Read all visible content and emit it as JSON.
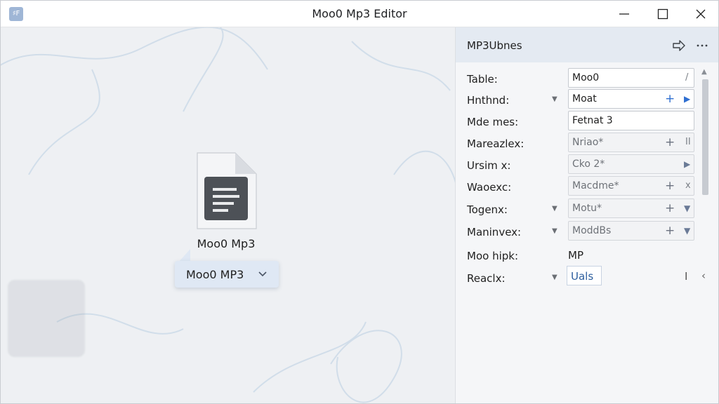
{
  "window": {
    "title": "Moo0 Mp3 Editor",
    "app_icon_glyph": "♯F"
  },
  "canvas": {
    "file_name": "Moo0 Mp3",
    "format_dropdown": {
      "selected": "Moo0 MP3"
    }
  },
  "panel": {
    "title": "MP3Ubnes",
    "rows": [
      {
        "label": "Table:",
        "value": "Moo0",
        "control": "text-field",
        "end_mark": "/",
        "disabled": false
      },
      {
        "label": "Hnthnd:",
        "value": "Moat",
        "control": "stepper-field",
        "has_dropdown": true,
        "disabled": false
      },
      {
        "label": "Mde mes:",
        "value": "Fetnat 3",
        "control": "text-field",
        "disabled": false
      },
      {
        "label": "Mareazlex:",
        "value": "Nriao*",
        "control": "stepper-field",
        "end_mark": "II",
        "disabled": true
      },
      {
        "label": "Ursim x:",
        "value": "Cko 2*",
        "control": "select-field",
        "disabled": true
      },
      {
        "label": "Waoexc:",
        "value": "Macdme*",
        "control": "stepper-field",
        "end_mark": "x",
        "disabled": true
      },
      {
        "label": "Togenx:",
        "value": "Motu*",
        "control": "stepper-field",
        "has_dropdown": true,
        "disabled": true
      },
      {
        "label": "Maninvex:",
        "value": "ModdBs",
        "control": "stepper-field",
        "has_dropdown": true,
        "disabled": true
      },
      {
        "label": "Moo hipk:",
        "value": "MP",
        "control": "plain-text"
      },
      {
        "label": "Reaclx:",
        "value": "Uals",
        "control": "link-field",
        "has_dropdown": true
      }
    ]
  },
  "colors": {
    "accent": "#2f6fd1",
    "panel_header": "#e4eaf2",
    "dropdown_bg": "#dfe8f4"
  },
  "icons": [
    "app-icon",
    "minimize-icon",
    "maximize-icon",
    "close-icon",
    "document-icon",
    "chevron-down-icon",
    "share-icon",
    "more-icon",
    "plus-icon",
    "triangle-right-icon",
    "chevron-left-icon",
    "text-cursor-icon"
  ]
}
